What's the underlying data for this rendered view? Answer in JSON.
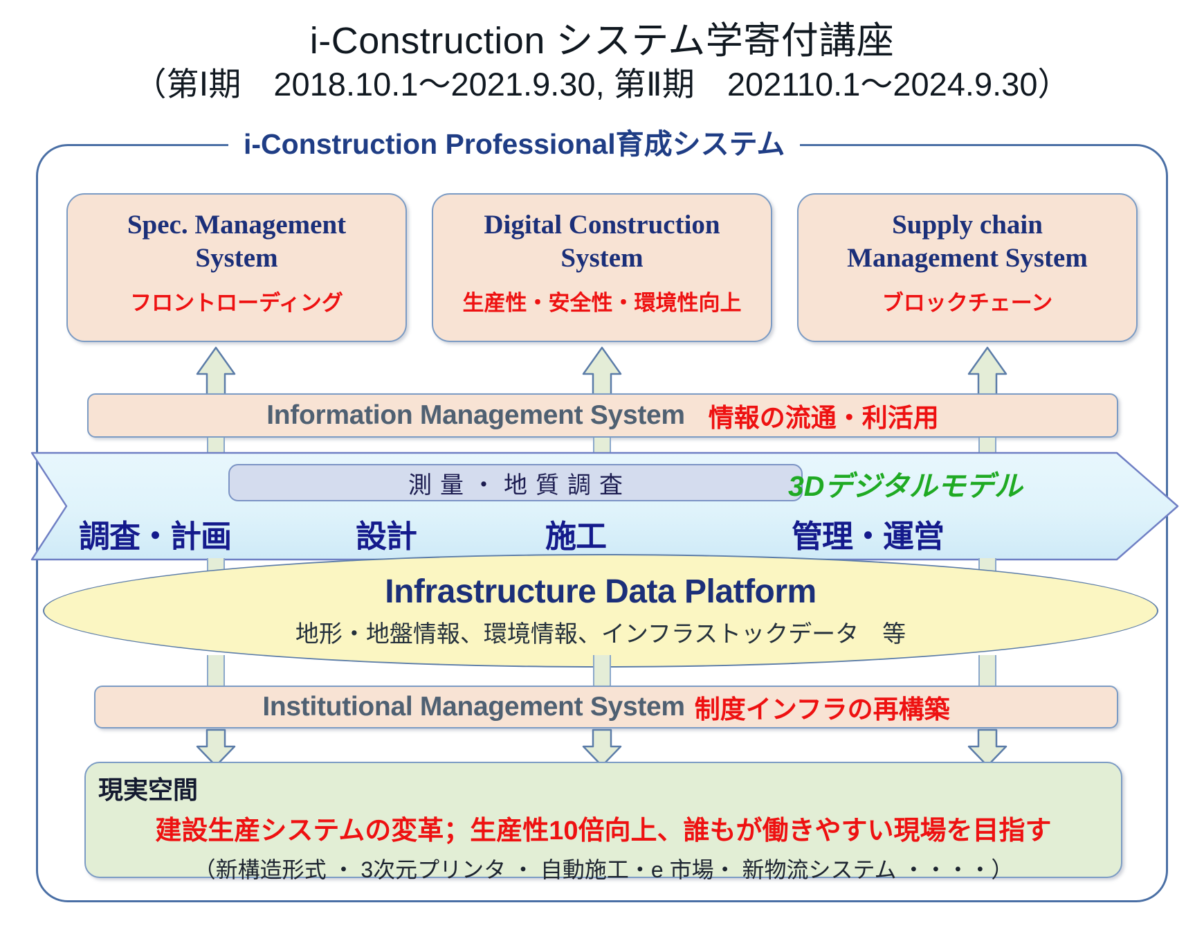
{
  "title": {
    "line1": "i-Construction システム学寄付講座",
    "line2": "（第Ⅰ期　2018.10.1～2021.9.30, 第Ⅱ期　202110.1～2024.9.30）"
  },
  "group": {
    "legend": "i-Construction Professional育成システム"
  },
  "systems": [
    {
      "title_en": "Spec. Management\nSystem",
      "subtitle_jp": "フロントローディング"
    },
    {
      "title_en": "Digital Construction\nSystem",
      "subtitle_jp": "生産性・安全性・環境性向上"
    },
    {
      "title_en": "Supply chain\nManagement System",
      "subtitle_jp": "ブロックチェーン"
    }
  ],
  "information_bar": {
    "label_en": "Information Management System",
    "label_jp": "情報の流通・利活用"
  },
  "process_band": {
    "survey_pill": "測量・地質調査",
    "model_label": "3Dデジタルモデル",
    "phases": [
      "調査・計画",
      "設計",
      "施工",
      "管理・運営"
    ]
  },
  "platform": {
    "title": "Infrastructure Data Platform",
    "subtitle": "地形・地盤情報、環境情報、インフラストックデータ　等"
  },
  "institutional_bar": {
    "label_en": "Institutional Management System",
    "label_jp": "制度インフラの再構築"
  },
  "reality": {
    "heading": "現実空間",
    "main": "建設生産システムの変革；生産性10倍向上、誰もが働きやすい現場を目指す",
    "note": "（新構造形式 ・ 3次元プリンタ ・ 自動施工・e 市場・ 新物流システム ・・・・）"
  },
  "colors": {
    "box_fill": "#f8e3d4",
    "box_border": "#7b9bc4",
    "title_navy": "#1b2f79",
    "accent_red": "#ee1111",
    "accent_green": "#1faa23",
    "arrow_fill": "#e4edd7",
    "band_fill": "#ddf3fb",
    "platform_fill": "#fbf6c2",
    "reality_fill": "#e2eed5"
  }
}
